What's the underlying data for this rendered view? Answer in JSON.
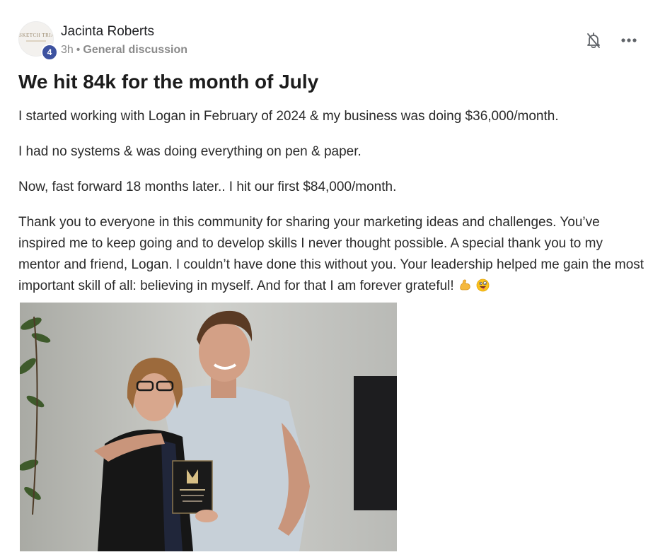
{
  "post": {
    "author": "Jacinta Roberts",
    "level": "4",
    "time": "3h",
    "separator": "•",
    "category": "General discussion",
    "avatar_text": "SKETCH TRIAL LINE",
    "title": "We hit 84k for the month of July",
    "paragraphs": [
      "I started working with Logan in February of 2024 & my business was doing $36,000/month.",
      "I had no systems & was doing everything on pen & paper.",
      "Now, fast forward 18 months later.. I hit our first $84,000/month.",
      "Thank you to everyone in this community for sharing your marketing ideas and challenges. You’ve inspired me to keep going and to develop skills I never thought possible. A special thank you to my mentor and friend, Logan. I couldn’t have done this without you. Your leadership helped me gain the most important skill of all: believing in myself. And for that I am forever grateful!"
    ],
    "emojis": [
      "flexed-biceps-emoji",
      "zany-face-emoji"
    ]
  },
  "icons": {
    "bell": "bell-off-icon",
    "more": "more-dots-icon"
  },
  "colors": {
    "level_badge": "#3d52a0",
    "meta_text": "#8a8a8a"
  }
}
